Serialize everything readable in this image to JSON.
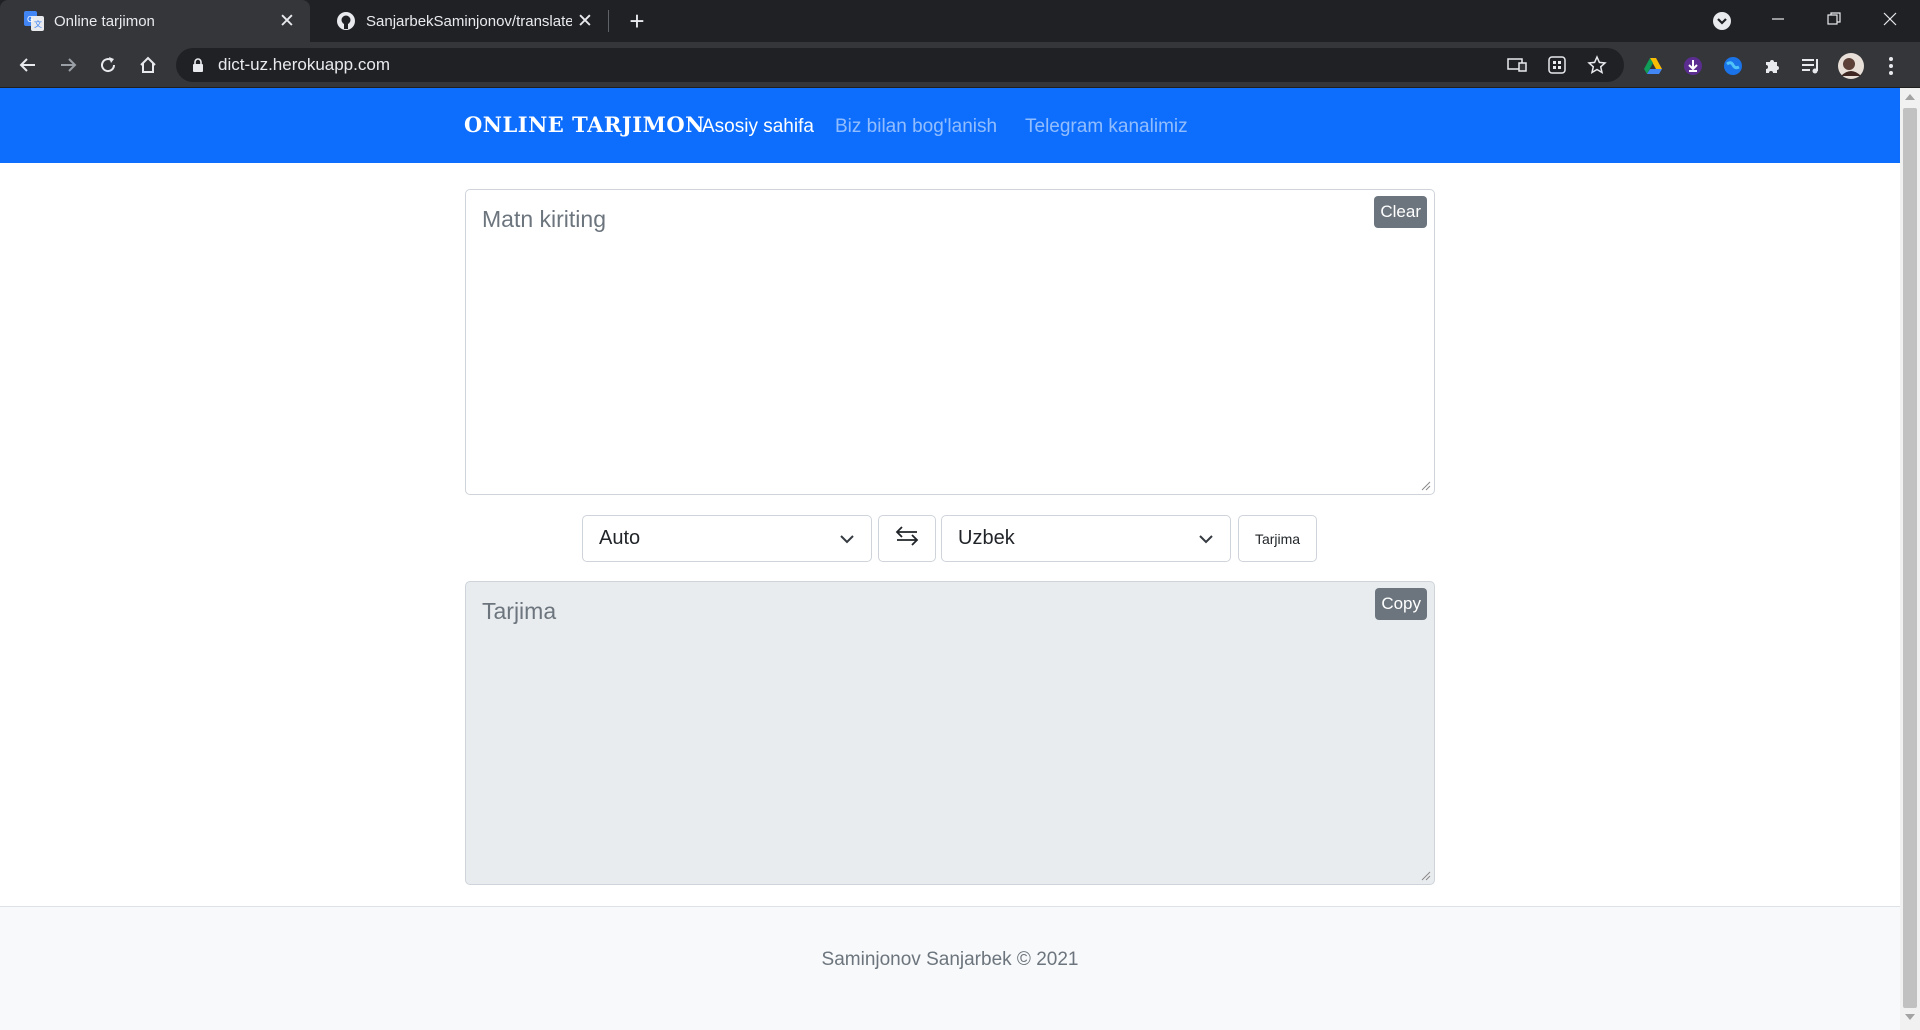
{
  "browser": {
    "tabs": [
      {
        "title": "Online tarjimon",
        "active": true,
        "icon": "google-translate-icon"
      },
      {
        "title": "SanjarbekSaminjonov/translate: C",
        "active": false,
        "icon": "github-icon"
      }
    ],
    "url": "dict-uz.herokuapp.com",
    "colors": {
      "frame": "#202124",
      "toolbar": "#35363a",
      "omnibox": "#202124"
    }
  },
  "navbar": {
    "brand": "ONLINE TARJIMON",
    "links": [
      {
        "label": "Asosiy sahifa",
        "active": true
      },
      {
        "label": "Biz bilan bog'lanish",
        "active": false
      },
      {
        "label": "Telegram kanalimiz",
        "active": false
      }
    ],
    "color": "#0d6efd"
  },
  "translator": {
    "input_placeholder": "Matn kiriting",
    "clear_label": "Clear",
    "source_language": "Auto",
    "target_language": "Uzbek",
    "translate_label": "Tarjima",
    "output_placeholder": "Tarjima",
    "copy_label": "Copy"
  },
  "footer": {
    "text": "Saminjonov Sanjarbek © 2021"
  }
}
